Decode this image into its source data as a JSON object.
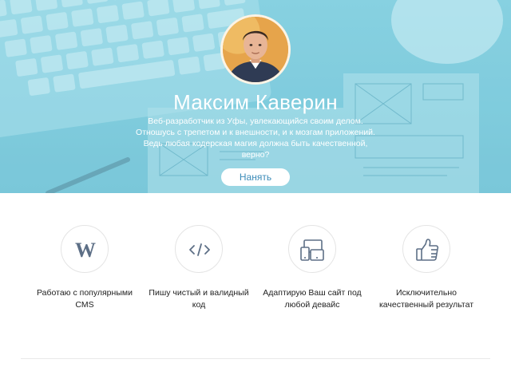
{
  "hero": {
    "name": "Максим Каверин",
    "bio_lines": [
      "Веб-разработчик из Уфы, увлекающийся своим делом.",
      "Отношусь с трепетом и к внешности, и к мозгам приложений.",
      "Ведь любая кодерская магия должна быть качественной,",
      "верно?"
    ],
    "hire_label": "Нанять"
  },
  "features": [
    {
      "icon": "wordpress-icon",
      "lines": [
        "Работаю с популярными",
        "CMS"
      ]
    },
    {
      "icon": "code-icon",
      "lines": [
        "Пишу чистый и валидный",
        "код"
      ]
    },
    {
      "icon": "devices-icon",
      "lines": [
        "Адаптирую Ваш сайт под",
        "любой девайс"
      ]
    },
    {
      "icon": "thumbs-up-icon",
      "lines": [
        "Исключительно",
        "качественный результат"
      ]
    }
  ],
  "colors": {
    "hero_tint": "#86cddd",
    "button_text": "#3b8bb8",
    "icon_stroke": "#5d6f86",
    "text": "#222222"
  }
}
